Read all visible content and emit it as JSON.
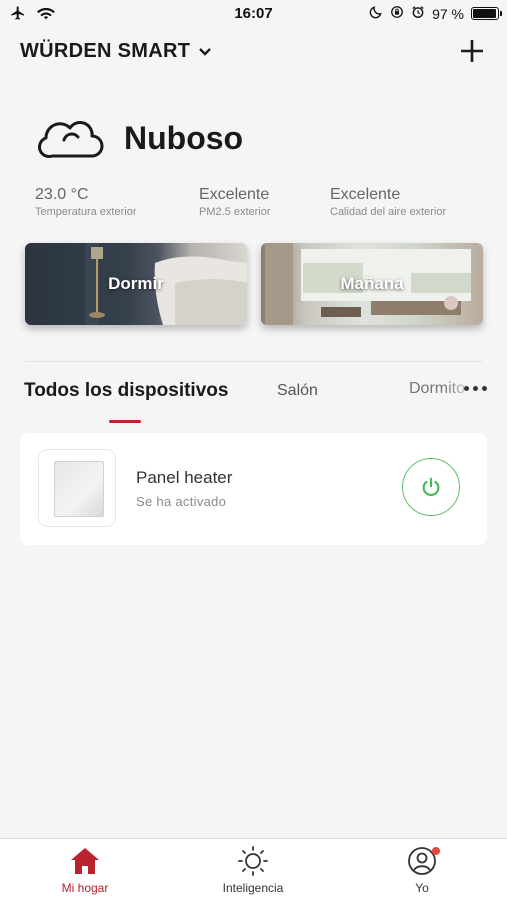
{
  "status_bar": {
    "time": "16:07",
    "battery": "97 %",
    "battery_level": 0.97,
    "icons": [
      "airplane-icon",
      "wifi-icon",
      "moon-icon",
      "rotation-lock-icon",
      "alarm-icon",
      "battery-icon"
    ]
  },
  "header": {
    "home_name": "WÜRDEN SMART",
    "icons": [
      "chevron-down-icon",
      "plus-icon"
    ]
  },
  "weather": {
    "condition": "Nuboso",
    "icon": "cloud-icon",
    "temperature": {
      "value": "23.0 °C",
      "label": "Temperatura exterior"
    },
    "pm25": {
      "value": "Excelente",
      "label": "PM2.5 exterior"
    },
    "air_quality": {
      "value": "Excelente",
      "label": "Calidad del aire exterior"
    }
  },
  "scenes": [
    {
      "label": "Dormir"
    },
    {
      "label": "Mañana"
    }
  ],
  "tabs": {
    "items": [
      "Todos los dispositivos",
      "Salón",
      "Dormito"
    ],
    "active_index": 0,
    "accent": "#b8232f"
  },
  "devices": [
    {
      "name": "Panel heater",
      "status": "Se ha activado",
      "power_color": "#5cc36a"
    }
  ],
  "nav": {
    "items": [
      {
        "label": "Mi hogar",
        "icon": "home-icon",
        "active": true
      },
      {
        "label": "Inteligencia",
        "icon": "sun-icon",
        "active": false
      },
      {
        "label": "Yo",
        "icon": "user-icon",
        "active": false
      }
    ],
    "accent": "#b8232f",
    "badge_color": "#e8453c"
  }
}
